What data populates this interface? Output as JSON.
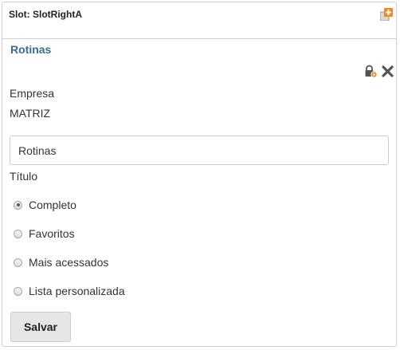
{
  "slot": {
    "title": "Slot: SlotRightA",
    "add_icon": "add-portlet-icon"
  },
  "portlet": {
    "title": "Rotinas",
    "tools": [
      "lock-settings-icon",
      "close-icon"
    ]
  },
  "form": {
    "company_label": "Empresa",
    "company_value": "MATRIZ",
    "title_input_value": "Rotinas",
    "title_label": "Título",
    "options": [
      {
        "label": "Completo",
        "checked": true
      },
      {
        "label": "Favoritos",
        "checked": false
      },
      {
        "label": "Mais acessados",
        "checked": false
      },
      {
        "label": "Lista personalizada",
        "checked": false
      }
    ],
    "save_label": "Salvar"
  },
  "colors": {
    "accent": "#3b6a96",
    "add_icon_orange": "#f08a1c"
  }
}
